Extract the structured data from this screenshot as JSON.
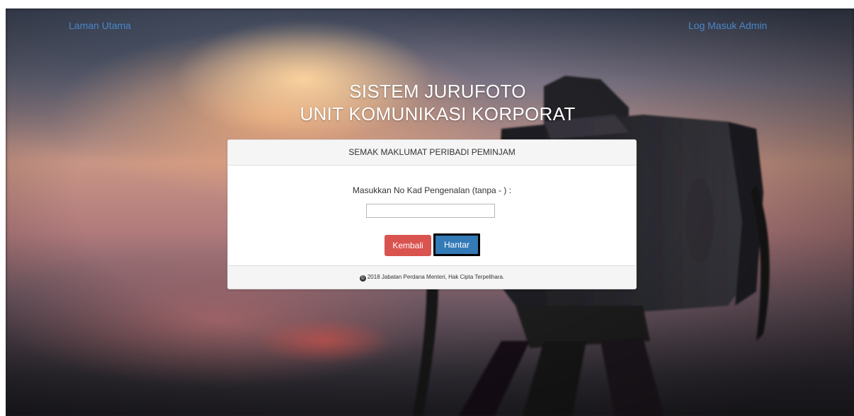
{
  "nav": {
    "home_label": "Laman Utama",
    "admin_label": "Log Masuk Admin"
  },
  "header": {
    "title_line1": "SISTEM JURUFOTO",
    "title_line2": "UNIT KOMUNIKASI KORPORAT"
  },
  "form": {
    "heading": "SEMAK MAKLUMAT PERIBADI PEMINJAM",
    "id_label": "Masukkan No Kad Pengenalan (tanpa - ) :",
    "id_value": "",
    "id_placeholder": "",
    "back_label": "Kembali",
    "submit_label": "Hantar"
  },
  "footer": {
    "copyright_icon": "copyright-icon",
    "copyright_text": "2018 Jabatan Perdana Menteri, Hak Cipta Terpelihara."
  },
  "colors": {
    "link": "#4a86c8",
    "danger": "#d9534f",
    "primary": "#337ab7",
    "panel_heading_bg": "#f5f5f5"
  }
}
